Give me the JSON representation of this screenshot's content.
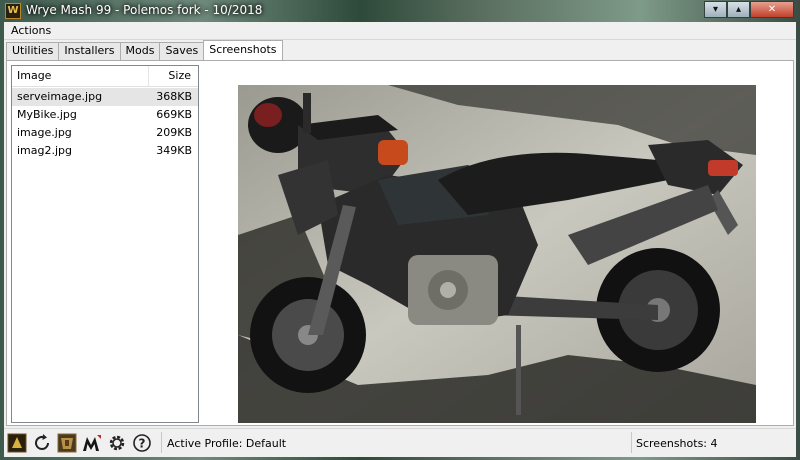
{
  "window": {
    "title": "Wrye Mash 99 - Polemos fork - 10/2018",
    "icon_glyph": "W",
    "controls": [
      "minimize",
      "maximize",
      "close"
    ]
  },
  "menu": {
    "actions": "Actions"
  },
  "tabs": [
    {
      "label": "Utilities",
      "active": false
    },
    {
      "label": "Installers",
      "active": false
    },
    {
      "label": "Mods",
      "active": false
    },
    {
      "label": "Saves",
      "active": false
    },
    {
      "label": "Screenshots",
      "active": true
    }
  ],
  "file_list": {
    "columns": {
      "image": "Image",
      "size": "Size"
    },
    "rows": [
      {
        "name": "serveimage.jpg",
        "size": "368KB",
        "selected": true
      },
      {
        "name": "MyBike.jpg",
        "size": "669KB",
        "selected": false
      },
      {
        "name": "image.jpg",
        "size": "209KB",
        "selected": false
      },
      {
        "name": "imag2.jpg",
        "size": "349KB",
        "selected": false
      }
    ]
  },
  "viewer": {
    "subject": "motorcycle photo"
  },
  "toolbar_icons": [
    "mod-tool-icon",
    "refresh-icon",
    "armor-tool-icon",
    "mlox-icon",
    "settings-gear-icon",
    "help-icon"
  ],
  "status": {
    "profile": "Active Profile: Default",
    "count": "Screenshots: 4"
  }
}
